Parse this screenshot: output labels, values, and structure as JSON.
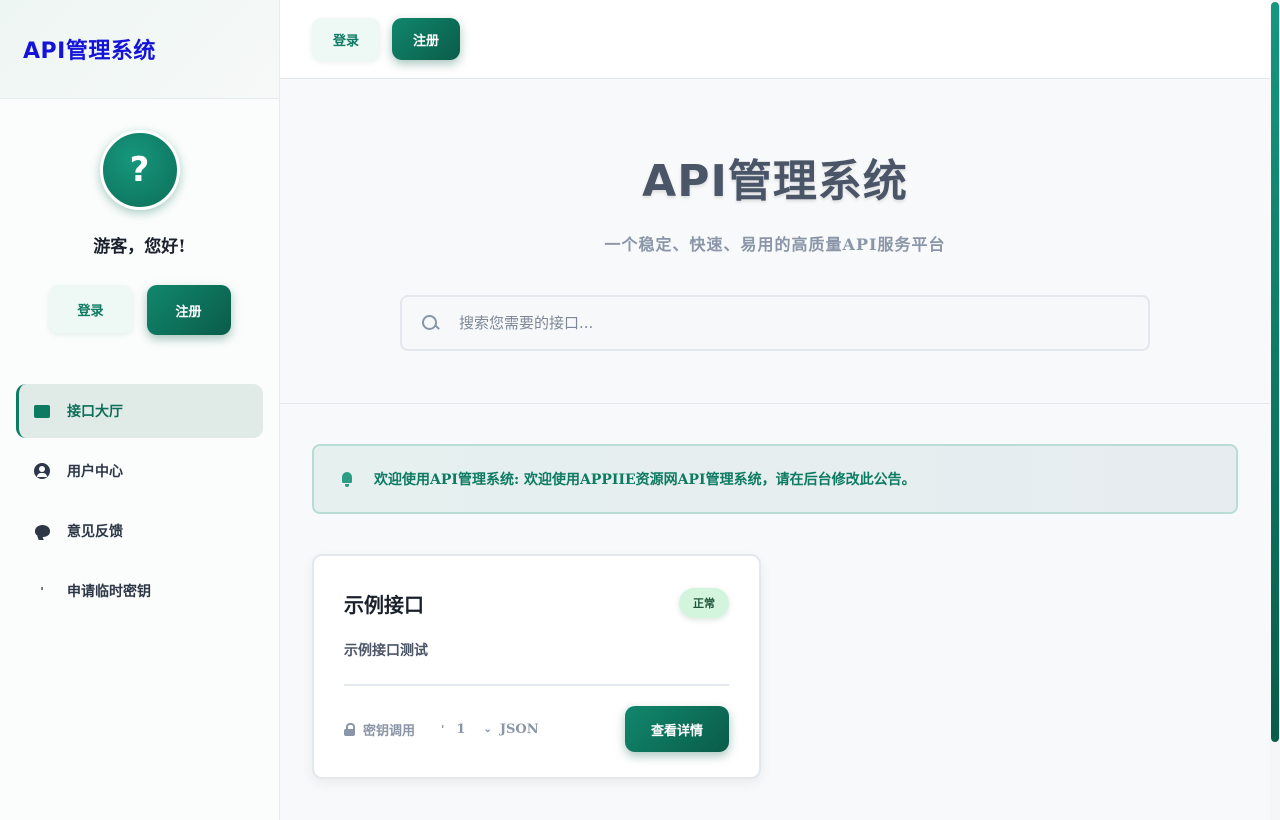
{
  "sidebar": {
    "brand": "API管理系统",
    "avatar_glyph": "?",
    "greeting": "游客，您好!",
    "login_label": "登录",
    "register_label": "注册",
    "items": [
      {
        "label": "接口大厅",
        "icon": "grid-icon",
        "active": true
      },
      {
        "label": "用户中心",
        "icon": "user-circle-icon",
        "active": false
      },
      {
        "label": "意见反馈",
        "icon": "comment-icon",
        "active": false
      },
      {
        "label": "申请临时密钥",
        "icon": "key-icon",
        "active": false
      }
    ]
  },
  "topbar": {
    "login_label": "登录",
    "register_label": "注册"
  },
  "hero": {
    "title": "API管理系统",
    "subtitle": "一个稳定、快速、易用的高质量API服务平台",
    "search_placeholder": "搜索您需要的接口..."
  },
  "notice": {
    "text": "欢迎使用API管理系统: 欢迎使用APPIIE资源网API管理系统，请在后台修改此公告。"
  },
  "card": {
    "title": "示例接口",
    "status": "正常",
    "description": "示例接口测试",
    "auth": "密钥调用",
    "sep_glyph": "'",
    "count": "1",
    "chevron_glyph": "⌄",
    "format": "JSON",
    "detail_label": "查看详情"
  },
  "colors": {
    "accent": "#0d7a62",
    "brand_text": "#1414d8",
    "status_bg": "#d4f5dd"
  }
}
